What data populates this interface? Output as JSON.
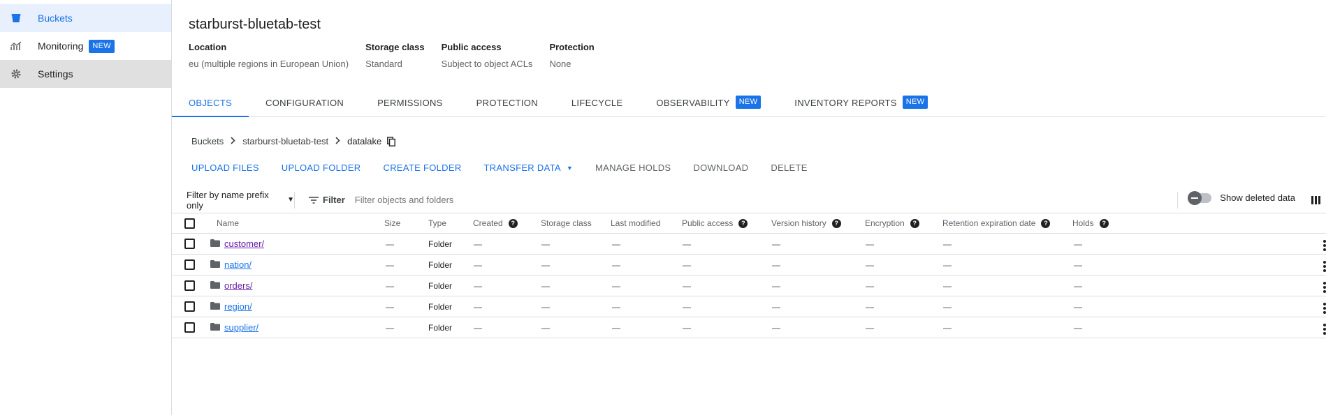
{
  "sidebar": {
    "items": [
      {
        "label": "Buckets",
        "icon": "bucket-icon"
      },
      {
        "label": "Monitoring",
        "icon": "chart-icon",
        "badge": "NEW"
      },
      {
        "label": "Settings",
        "icon": "gear-icon"
      }
    ]
  },
  "bucket": {
    "title": "starburst-bluetab-test",
    "properties": [
      {
        "label": "Location",
        "value": "eu (multiple regions in European Union)"
      },
      {
        "label": "Storage class",
        "value": "Standard"
      },
      {
        "label": "Public access",
        "value": "Subject to object ACLs"
      },
      {
        "label": "Protection",
        "value": "None"
      }
    ]
  },
  "tabs": [
    {
      "label": "OBJECTS",
      "active": true
    },
    {
      "label": "CONFIGURATION"
    },
    {
      "label": "PERMISSIONS"
    },
    {
      "label": "PROTECTION"
    },
    {
      "label": "LIFECYCLE"
    },
    {
      "label": "OBSERVABILITY",
      "badge": "NEW"
    },
    {
      "label": "INVENTORY REPORTS",
      "badge": "NEW"
    }
  ],
  "breadcrumb": {
    "items": [
      "Buckets",
      "starburst-bluetab-test"
    ],
    "current": "datalake"
  },
  "actions": [
    {
      "label": "UPLOAD FILES"
    },
    {
      "label": "UPLOAD FOLDER"
    },
    {
      "label": "CREATE FOLDER"
    },
    {
      "label": "TRANSFER DATA",
      "dropdown": true
    },
    {
      "label": "MANAGE HOLDS",
      "disabled": true
    },
    {
      "label": "DOWNLOAD",
      "disabled": true
    },
    {
      "label": "DELETE",
      "disabled": true
    }
  ],
  "filter": {
    "mode": "Filter by name prefix only",
    "button": "Filter",
    "placeholder": "Filter objects and folders",
    "toggle_label": "Show deleted data"
  },
  "table": {
    "columns": [
      "Name",
      "Size",
      "Type",
      "Created",
      "Storage class",
      "Last modified",
      "Public access",
      "Version history",
      "Encryption",
      "Retention expiration date",
      "Holds"
    ],
    "help_columns": [
      "Created",
      "Public access",
      "Version history",
      "Encryption",
      "Retention expiration date",
      "Holds"
    ],
    "rows": [
      {
        "name": "customer/",
        "visited": true,
        "size": "—",
        "type": "Folder",
        "created": "—",
        "storage_class": "—",
        "last_modified": "—",
        "public_access": "—",
        "version_history": "—",
        "encryption": "—",
        "retention": "—",
        "holds": "—"
      },
      {
        "name": "nation/",
        "visited": false,
        "size": "—",
        "type": "Folder",
        "created": "—",
        "storage_class": "—",
        "last_modified": "—",
        "public_access": "—",
        "version_history": "—",
        "encryption": "—",
        "retention": "—",
        "holds": "—"
      },
      {
        "name": "orders/",
        "visited": true,
        "size": "—",
        "type": "Folder",
        "created": "—",
        "storage_class": "—",
        "last_modified": "—",
        "public_access": "—",
        "version_history": "—",
        "encryption": "—",
        "retention": "—",
        "holds": "—"
      },
      {
        "name": "region/",
        "visited": false,
        "size": "—",
        "type": "Folder",
        "created": "—",
        "storage_class": "—",
        "last_modified": "—",
        "public_access": "—",
        "version_history": "—",
        "encryption": "—",
        "retention": "—",
        "holds": "—"
      },
      {
        "name": "supplier/",
        "visited": false,
        "size": "—",
        "type": "Folder",
        "created": "—",
        "storage_class": "—",
        "last_modified": "—",
        "public_access": "—",
        "version_history": "—",
        "encryption": "—",
        "retention": "—",
        "holds": "—"
      }
    ]
  },
  "colors": {
    "accent": "#1a73e8",
    "visited_link": "#681da8",
    "badge_bg": "#1a73e8",
    "sidebar_active_bg": "#e8f0fe",
    "sidebar_hover_bg": "#e0e0e0"
  }
}
